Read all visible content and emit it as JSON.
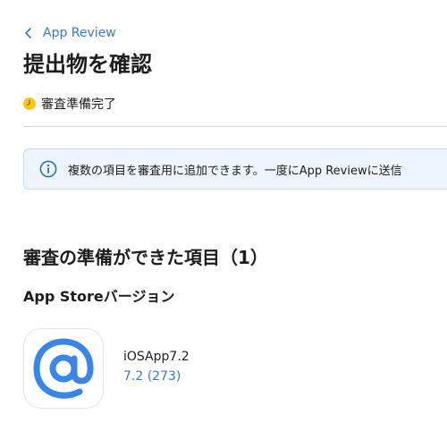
{
  "nav": {
    "back_label": "App Review"
  },
  "header": {
    "title": "提出物を確認",
    "status_text": "審査準備完了",
    "status_color": "#f5c518"
  },
  "banner": {
    "text": "複数の項目を審査用に追加できます。一度にApp Reviewに送信"
  },
  "section": {
    "heading": "審査の準備ができた項目（1）",
    "subheading": "App Storeバージョン"
  },
  "app": {
    "name": "iOSApp7.2",
    "version": "7.2 (273)",
    "icon": "at-sign-icon",
    "icon_color": "#3a86e8"
  },
  "colors": {
    "accent": "#3a79c9",
    "banner_bg": "#edf4fb",
    "divider": "#d2d2d7"
  }
}
